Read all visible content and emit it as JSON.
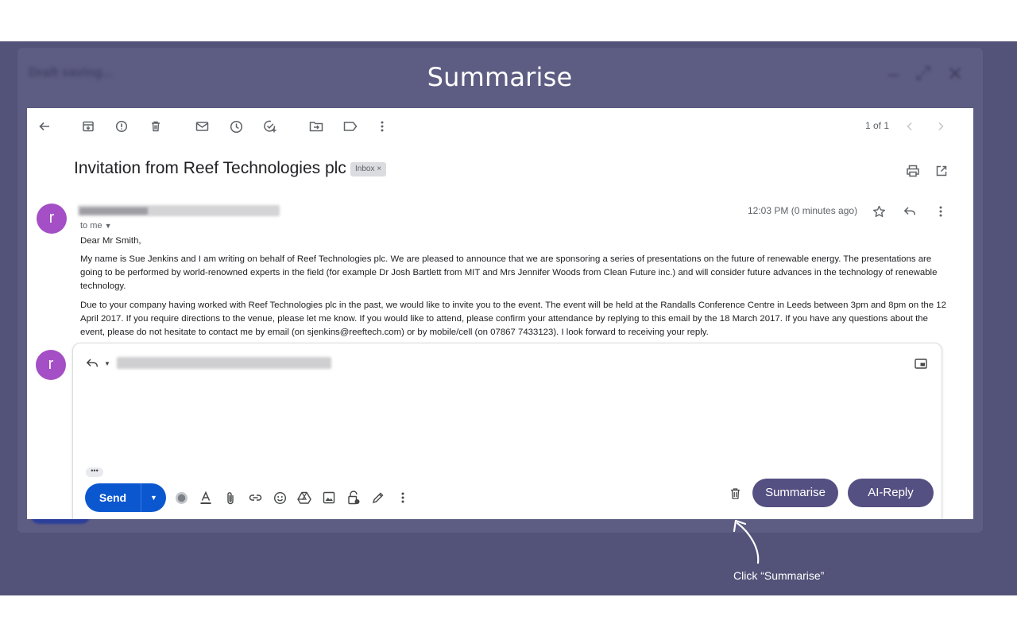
{
  "background": {
    "draft_status": "Draft saving...",
    "slide_title": "Summarise"
  },
  "toolbar": {
    "icons": [
      "back-arrow-icon",
      "archive-icon",
      "report-spam-icon",
      "delete-icon",
      "mark-unread-icon",
      "snooze-icon",
      "add-task-icon",
      "move-to-icon",
      "label-icon",
      "more-icon"
    ],
    "counter": "1 of 1"
  },
  "email": {
    "subject": "Invitation from Reef Technologies plc",
    "label": "Inbox ×",
    "sender_initial": "r",
    "to_label": "to me",
    "timestamp": "12:03 PM (0 minutes ago)",
    "greeting": "Dear Mr Smith,",
    "paragraph1": "My name is Sue Jenkins and I am writing on behalf of Reef Technologies plc. We are pleased to announce that we are sponsoring a series of presentations on the future of renewable energy. The presentations are going to be performed by world-renowned experts in the field (for example Dr Josh Bartlett from MIT and Mrs Jennifer Woods from Clean Future inc.) and will consider future advances in the technology of renewable technology.",
    "paragraph2": "Due to your company having worked with Reef Technologies plc in the past, we would like to invite you to the event. The event will be held at the Randalls Conference Centre in Leeds between 3pm and 8pm on the 12 April 2017. If you require directions to the venue, please let me know. If you would like to attend, please confirm your attendance by replying to this email by the 18 March 2017. If you have any questions about the event, please do not hesitate to contact me by email (on sjenkins@reeftech.com) or by mobile/cell (on 07867 7433123). I look forward to receiving your reply."
  },
  "reply": {
    "user_initial": "r",
    "expand_label": "•••",
    "send_label": "Send",
    "summarise_label": "Summarise",
    "ai_reply_label": "AI-Reply"
  },
  "callout": {
    "text": "Click “Summarise”"
  },
  "colors": {
    "stage_bg": "#535278",
    "accent_pill": "#545082",
    "send_blue": "#0b57d0",
    "avatar_purple": "#a44fc5"
  }
}
